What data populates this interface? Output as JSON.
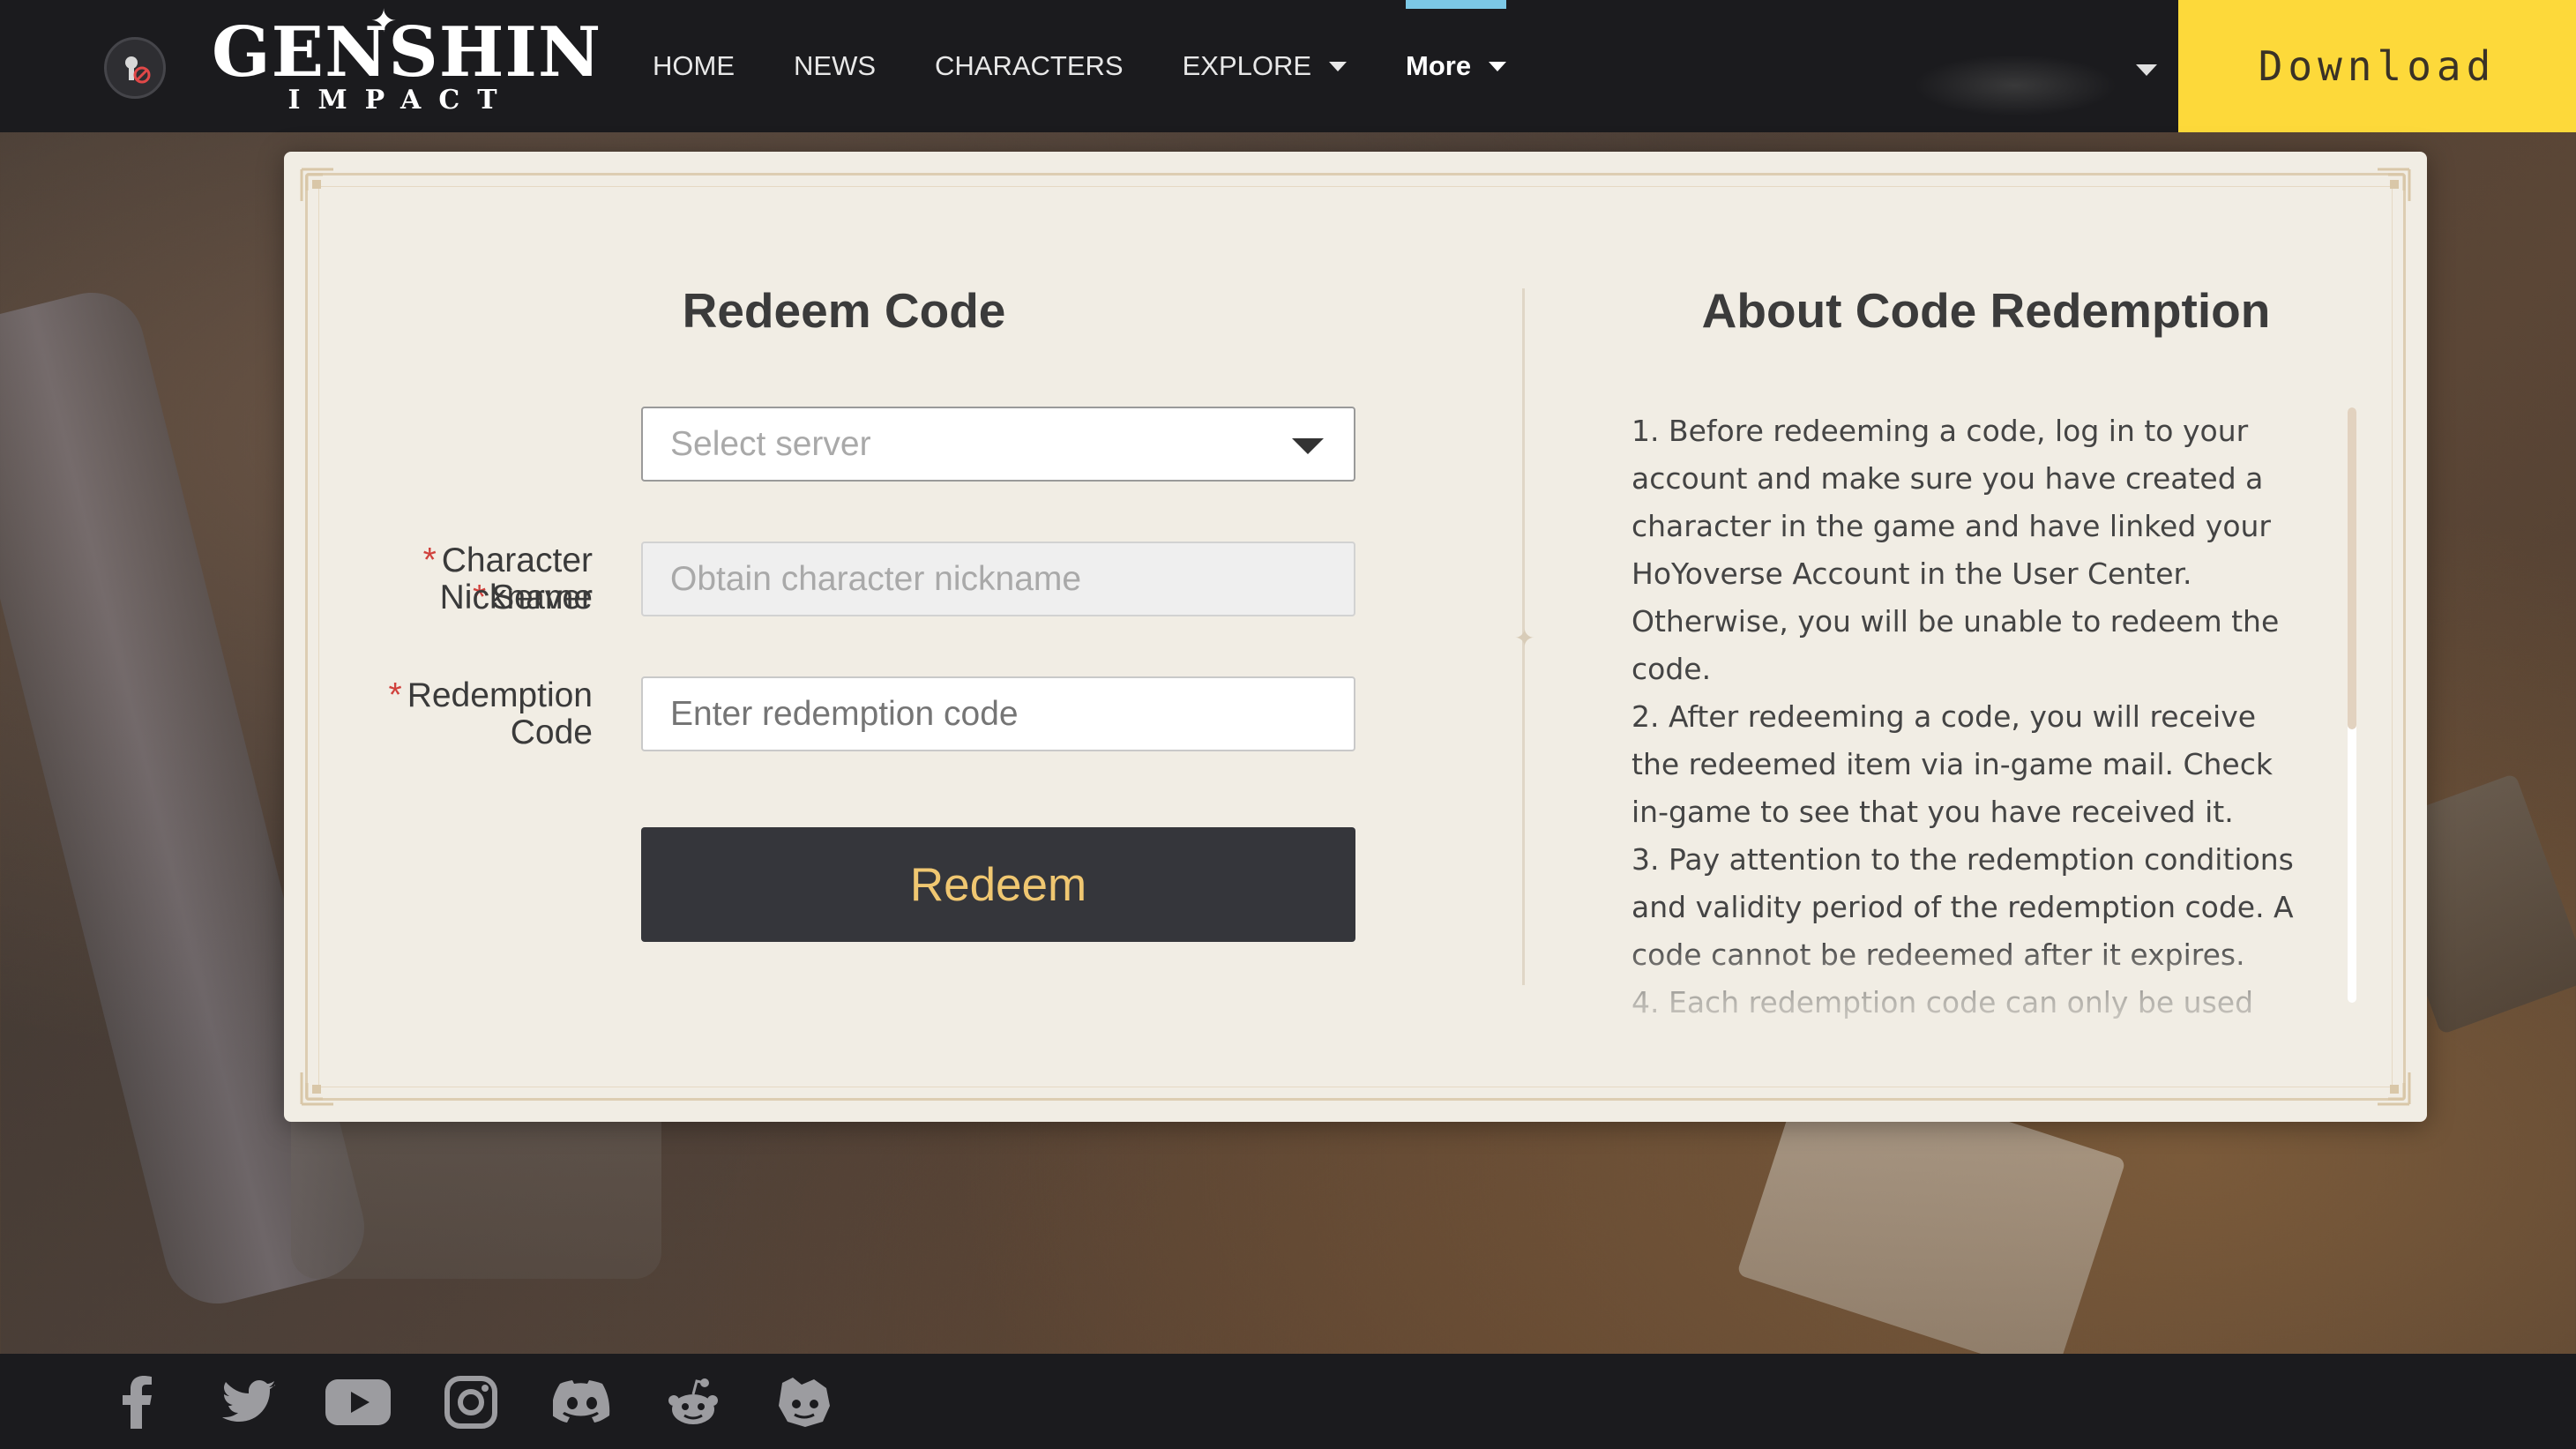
{
  "header": {
    "logo_main": "GENSHIN",
    "logo_sub": "IMPACT",
    "nav": [
      {
        "label": "HOME"
      },
      {
        "label": "NEWS"
      },
      {
        "label": "CHARACTERS"
      },
      {
        "label": "EXPLORE"
      },
      {
        "label": "More"
      }
    ],
    "download_label": "Download"
  },
  "redeem": {
    "title": "Redeem Code",
    "required_mark": "*",
    "server_label": "Server",
    "server_placeholder": "Select server",
    "nickname_label_line1": "Character",
    "nickname_label_line2": "Nickname",
    "nickname_placeholder": "Obtain character nickname",
    "code_label_line1": "Redemption",
    "code_label_line2": "Code",
    "code_placeholder": "Enter redemption code",
    "button_label": "Redeem"
  },
  "about": {
    "title": "About Code Redemption",
    "items": [
      "1. Before redeeming a code, log in to your account and make sure you have created a character in the game and have linked your HoYoverse Account in the User Center. Otherwise, you will be unable to redeem the code.",
      "2. After redeeming a code, you will receive the redeemed item via in-game mail. Check in-game to see that you have received it.",
      "3. Pay attention to the redemption conditions and validity period of the redemption code. A code cannot be redeemed after it expires.",
      "4. Each redemption code can only be used"
    ]
  },
  "footer": {
    "social_icons": [
      "facebook-icon",
      "twitter-icon",
      "youtube-icon",
      "instagram-icon",
      "discord-icon",
      "reddit-icon",
      "hoyolab-icon"
    ]
  },
  "colors": {
    "header_bg": "#1b1b1e",
    "download_bg": "#fdd93a",
    "panel_bg": "#f1ede4",
    "button_bg": "#35363b",
    "button_text": "#f0c771",
    "required": "#d0413c",
    "nav_active_bar": "#7cc8e6"
  }
}
